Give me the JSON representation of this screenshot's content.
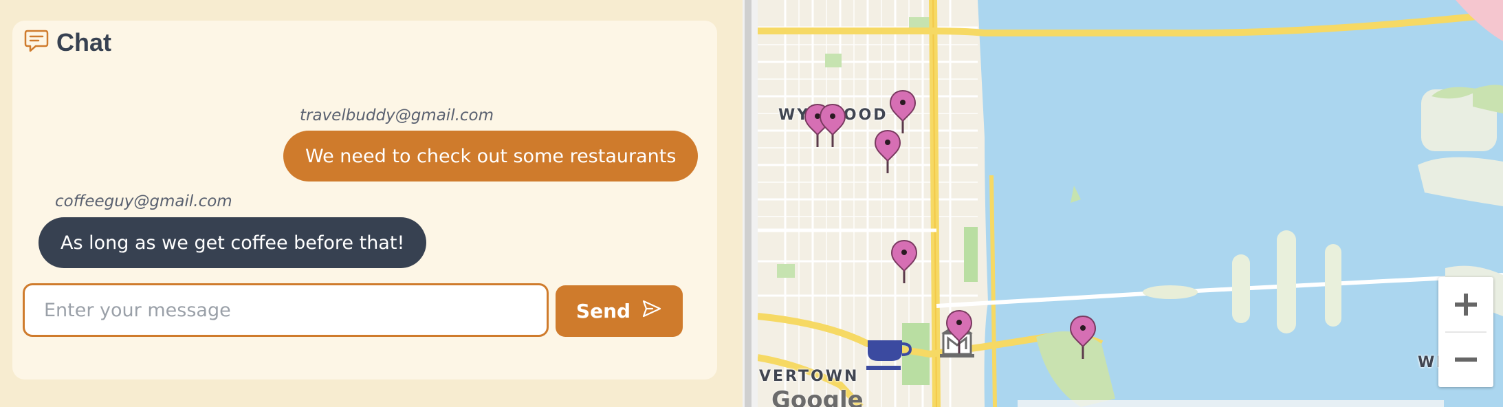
{
  "chat": {
    "title": "Chat",
    "icon": "chat-bubble-icon",
    "messages": [
      {
        "sender": "travelbuddy@gmail.com",
        "text": "We need to check out some restaurants",
        "own": true
      },
      {
        "sender": "coffeeguy@gmail.com",
        "text": "As long as we get coffee before that!",
        "own": false
      }
    ],
    "input": {
      "placeholder": "Enter your message",
      "value": ""
    },
    "send_label": "Send",
    "send_icon": "paper-plane-icon"
  },
  "map": {
    "labels": {
      "wynwood": "WYNWOOD",
      "overtown": "VERTOWN",
      "edge": "WE",
      "logo": "Google"
    },
    "markers": [
      "map-pin-icon",
      "map-pin-icon",
      "map-pin-icon",
      "map-pin-icon",
      "map-pin-icon",
      "map-pin-icon",
      "map-pin-icon"
    ],
    "poi_icons": [
      "coffee-cup-icon",
      "museum-icon"
    ],
    "zoom_in_label": "+",
    "zoom_out_label": "−"
  },
  "colors": {
    "accent": "#cf7b2c",
    "dark_bubble": "#374151",
    "background": "#f7ecd0",
    "card": "#fdf6e6",
    "water": "#abd6ef",
    "pin": "#d66fb4"
  }
}
